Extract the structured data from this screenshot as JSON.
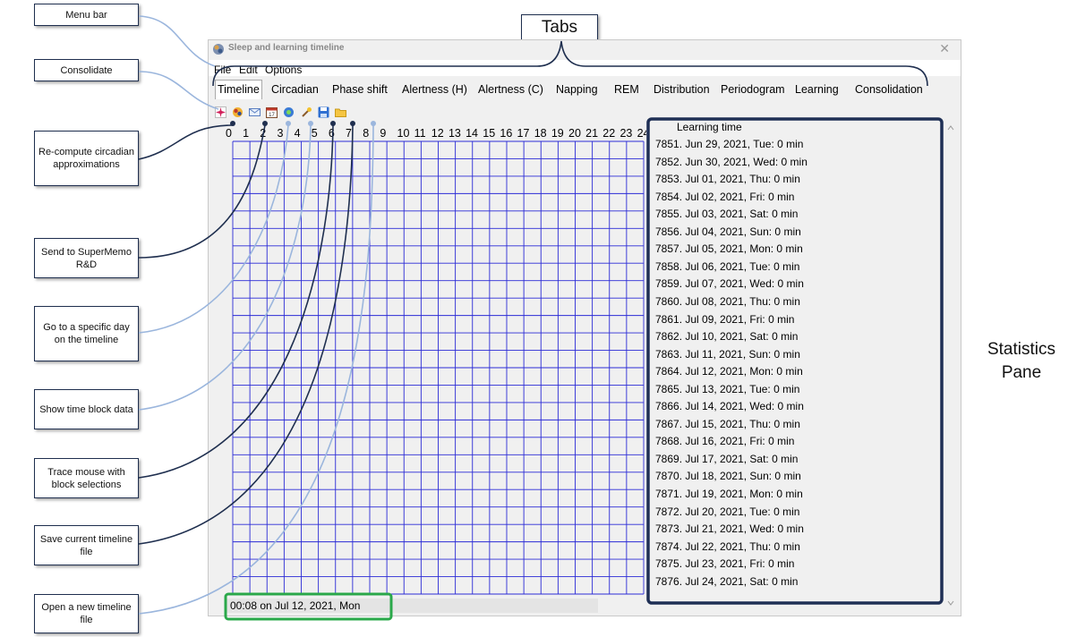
{
  "window": {
    "title": "Sleep and learning timeline",
    "close_glyph": "✕"
  },
  "menu": [
    "File",
    "Edit",
    "Options"
  ],
  "tabs": [
    "Timeline",
    "Circadian",
    "Phase shift",
    "Alertness (H)",
    "Alertness (C)",
    "Napping",
    "REM",
    "Distribution",
    "Periodogram",
    "Learning",
    "Consolidation"
  ],
  "active_tab": "Timeline",
  "toolbar_icons": [
    "consolidate-icon",
    "recompute-circadian-icon",
    "send-mail-icon",
    "calendar-goto-day-icon",
    "block-data-icon",
    "trace-mouse-icon",
    "save-icon",
    "open-folder-icon"
  ],
  "hours": [
    "0",
    "1",
    "2",
    "3",
    "4",
    "5",
    "6",
    "7",
    "8",
    "9",
    "10",
    "11",
    "12",
    "13",
    "14",
    "15",
    "16",
    "17",
    "18",
    "19",
    "20",
    "21",
    "22",
    "23",
    "24"
  ],
  "status": "00:08 on Jul 12, 2021, Mon",
  "stats": {
    "title": "Learning time",
    "rows": [
      "7851. Jun 29, 2021, Tue: 0 min",
      "7852. Jun 30, 2021, Wed: 0 min",
      "7853. Jul 01, 2021, Thu: 0 min",
      "7854. Jul 02, 2021, Fri: 0 min",
      "7855. Jul 03, 2021, Sat: 0 min",
      "7856. Jul 04, 2021, Sun: 0 min",
      "7857. Jul 05, 2021, Mon: 0 min",
      "7858. Jul 06, 2021, Tue: 0 min",
      "7859. Jul 07, 2021, Wed: 0 min",
      "7860. Jul 08, 2021, Thu: 0 min",
      "7861. Jul 09, 2021, Fri: 0 min",
      "7862. Jul 10, 2021, Sat: 0 min",
      "7863. Jul 11, 2021, Sun: 0 min",
      "7864. Jul 12, 2021, Mon: 0 min",
      "7865. Jul 13, 2021, Tue: 0 min",
      "7866. Jul 14, 2021, Wed: 0 min",
      "7867. Jul 15, 2021, Thu: 0 min",
      "7868. Jul 16, 2021, Fri: 0 min",
      "7869. Jul 17, 2021, Sat: 0 min",
      "7870. Jul 18, 2021, Sun: 0 min",
      "7871. Jul 19, 2021, Mon: 0 min",
      "7872. Jul 20, 2021, Tue: 0 min",
      "7873. Jul 21, 2021, Wed: 0 min",
      "7874. Jul 22, 2021, Thu: 0 min",
      "7875. Jul 23, 2021, Fri: 0 min",
      "7876. Jul 24, 2021, Sat: 0 min"
    ]
  },
  "annotations": {
    "menu_bar": "Menu bar",
    "consolidate": "Consolidate",
    "recompute": "Re-compute circadian approximations",
    "send": "Send to SuperMemo R&D",
    "goto_day": "Go to a specific day on the timeline",
    "show_block": "Show time block data",
    "trace_mouse": "Trace mouse with block selections",
    "save_file": "Save current timeline file",
    "open_file": "Open a new timeline file",
    "tabs": "Tabs",
    "stats_pane_line1": "Statistics",
    "stats_pane_line2": "Pane"
  },
  "colors": {
    "grid": "#2b2bd6",
    "callout_line_dark": "#1f2f4f",
    "callout_line_light": "#9bb6dd",
    "status_highlight": "#2aa84a",
    "stats_border": "#1f2f55"
  }
}
